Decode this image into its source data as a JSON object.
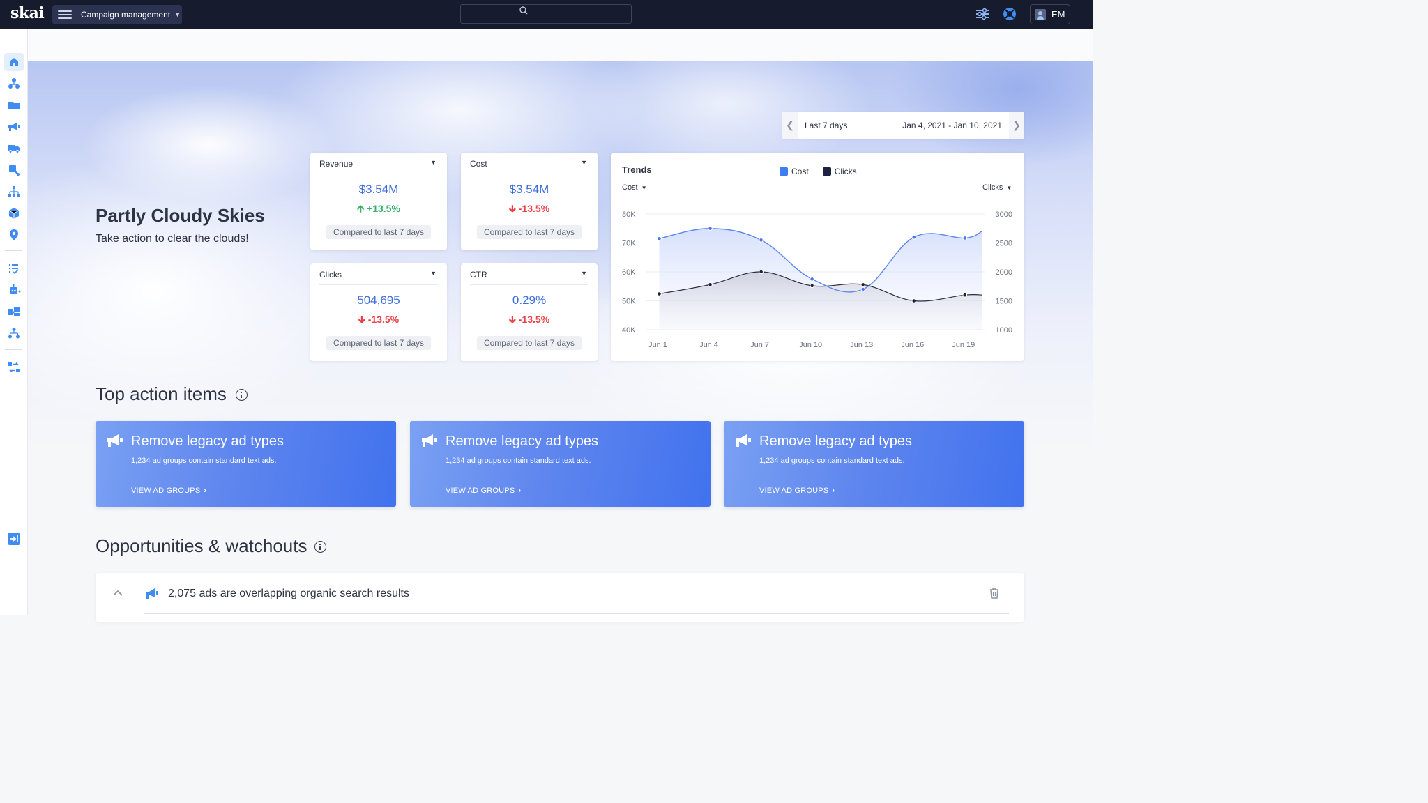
{
  "app": {
    "logo": "skai",
    "menu_label": "Campaign management",
    "user_initials": "EM"
  },
  "colors": {
    "topbar": "#161b2e",
    "accent": "#3e6ddf",
    "positive": "#35b26a",
    "negative": "#ea3f46",
    "cost_series": "#5b86ee",
    "clicks_series": "#2a2c40"
  },
  "sidebar": {
    "items": [
      {
        "icon": "home-icon",
        "active": true
      },
      {
        "icon": "hierarchy-icon"
      },
      {
        "icon": "folder-icon"
      },
      {
        "icon": "megaphone-icon"
      },
      {
        "icon": "truck-icon"
      },
      {
        "icon": "tools-icon"
      },
      {
        "icon": "org-chart-icon"
      },
      {
        "icon": "cube-icon"
      },
      {
        "icon": "location-pin-icon"
      },
      {
        "icon": "task-list-icon"
      },
      {
        "icon": "robot-icon"
      },
      {
        "icon": "puzzle-icon"
      },
      {
        "icon": "sitemap-icon"
      },
      {
        "icon": "integrations-icon"
      },
      {
        "icon": "expand-sidebar-icon"
      }
    ]
  },
  "hero": {
    "headline": "Partly Cloudy Skies",
    "subline": "Take action to clear the clouds!"
  },
  "date_range": {
    "preset": "Last 7 days",
    "dates": "Jan 4, 2021 - Jan 10, 2021"
  },
  "kpis": [
    {
      "label": "Revenue",
      "value": "$3.54M",
      "delta": "+13.5%",
      "direction": "up",
      "compare": "Compared to last 7 days"
    },
    {
      "label": "Cost",
      "value": "$3.54M",
      "delta": "-13.5%",
      "direction": "down",
      "compare": "Compared to last 7 days"
    },
    {
      "label": "Clicks",
      "value": "504,695",
      "delta": "-13.5%",
      "direction": "down",
      "compare": "Compared to last 7 days"
    },
    {
      "label": "CTR",
      "value": "0.29%",
      "delta": "-13.5%",
      "direction": "down",
      "compare": "Compared to last 7 days"
    }
  ],
  "trends": {
    "title": "Trends",
    "left_selector": "Cost",
    "right_selector": "Clicks",
    "legend": [
      {
        "name": "Cost",
        "color": "#5b86ee"
      },
      {
        "name": "Clicks",
        "color": "#2a2c40"
      }
    ]
  },
  "chart_data": {
    "type": "line",
    "title": "Trends",
    "x": [
      "Jun 1",
      "Jun 4",
      "Jun 7",
      "Jun 10",
      "Jun 13",
      "Jun 16",
      "Jun 19"
    ],
    "y_left_ticks": [
      "80K",
      "70K",
      "60K",
      "50K",
      "40K"
    ],
    "y_right_ticks": [
      "3000",
      "2500",
      "2000",
      "1500",
      "1000"
    ],
    "y_left_range": [
      40000,
      80000
    ],
    "y_right_range": [
      1000,
      3000
    ],
    "grid": true,
    "legend_position": "top-center",
    "series": [
      {
        "name": "Cost",
        "axis": "left",
        "values": [
          71500,
          75000,
          71000,
          57500,
          54000,
          72000,
          71700,
          74000
        ]
      },
      {
        "name": "Clicks",
        "axis": "right",
        "values": [
          1620,
          1780,
          2000,
          1760,
          1780,
          1500,
          1600,
          1600
        ]
      }
    ],
    "point_x_days": [
      1,
      4,
      7,
      10,
      13,
      16,
      19,
      20
    ]
  },
  "action_section": {
    "title": "Top action items",
    "cards": [
      {
        "title": "Remove legacy ad types",
        "desc": "1,234 ad groups contain standard text ads.",
        "link": "VIEW AD GROUPS"
      },
      {
        "title": "Remove legacy ad types",
        "desc": "1,234 ad groups contain standard text ads.",
        "link": "VIEW AD GROUPS"
      },
      {
        "title": "Remove legacy ad types",
        "desc": "1,234 ad groups contain standard text ads.",
        "link": "VIEW AD GROUPS"
      }
    ]
  },
  "opportunities": {
    "title": "Opportunities & watchouts",
    "items": [
      {
        "text": "2,075 ads are overlapping organic search results"
      }
    ]
  }
}
